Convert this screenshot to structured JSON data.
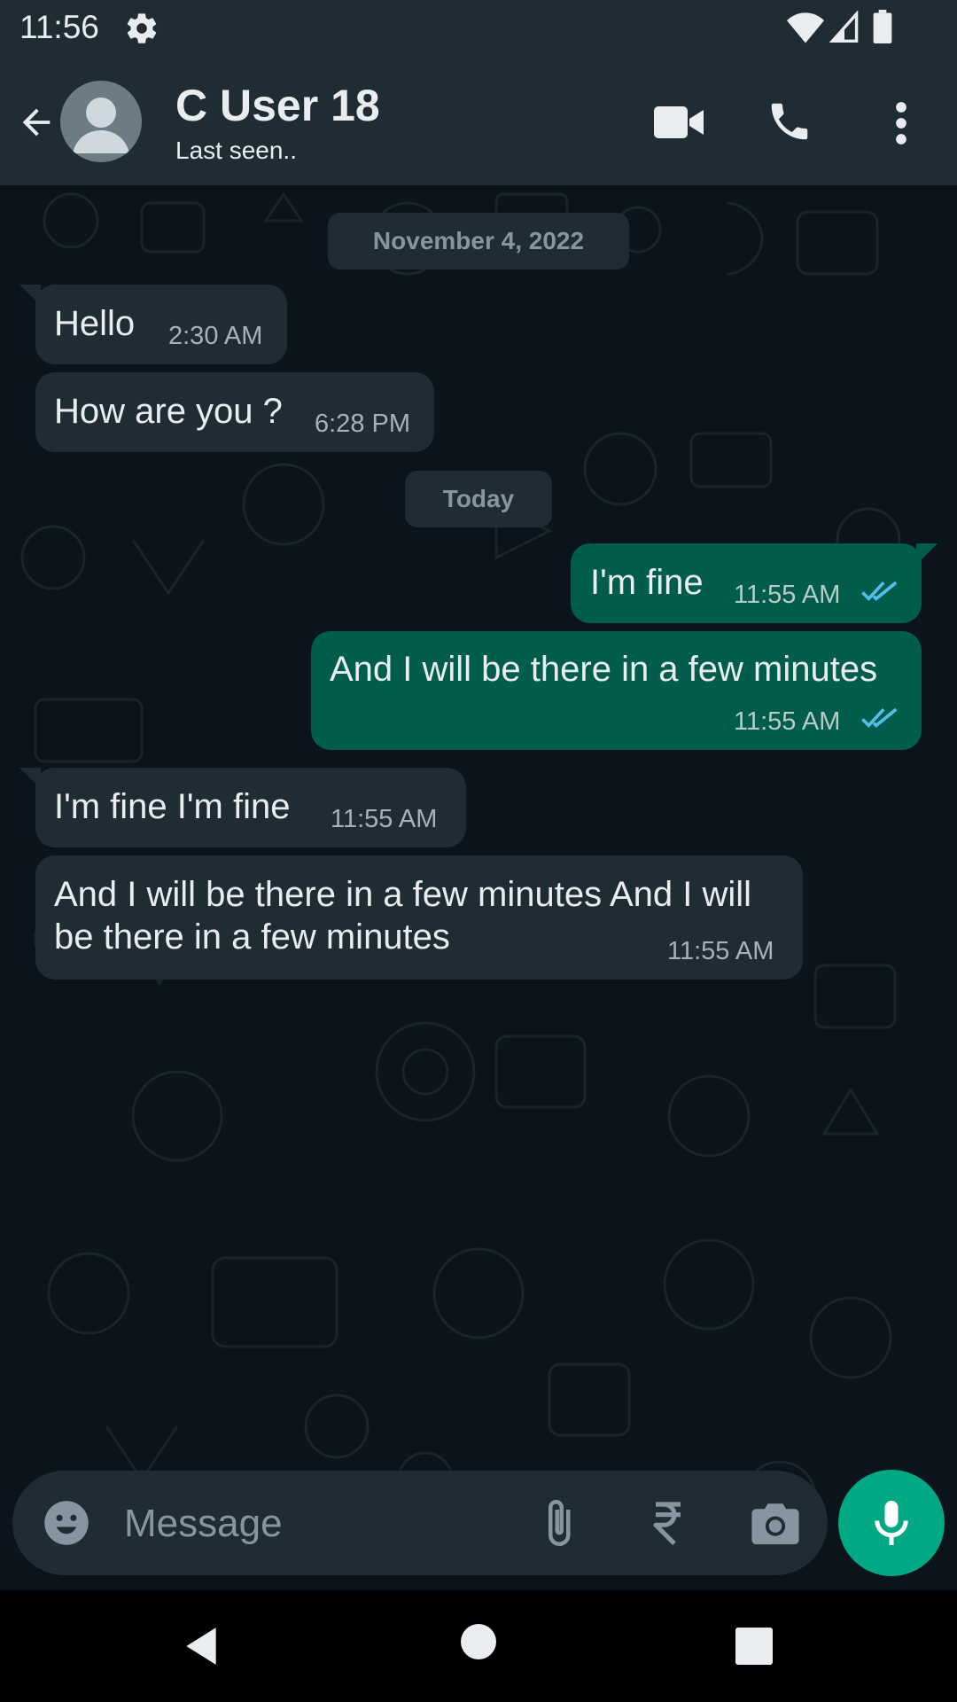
{
  "status_bar": {
    "time": "11:56",
    "icons": [
      "gear-icon",
      "wifi-icon",
      "signal-icon",
      "battery-icon"
    ]
  },
  "header": {
    "contact_name": "C User 18",
    "contact_status": "Last seen..",
    "actions": [
      "video-call-icon",
      "voice-call-icon",
      "more-options-icon"
    ]
  },
  "chat": {
    "date_chips": [
      "November 4, 2022",
      "Today"
    ],
    "messages": [
      {
        "direction": "in",
        "text": "Hello",
        "time": "2:30 AM"
      },
      {
        "direction": "in",
        "text": "How are you ?",
        "time": "6:28 PM"
      },
      {
        "direction": "out",
        "text": "I'm fine",
        "time": "11:55 AM",
        "status": "read"
      },
      {
        "direction": "out",
        "text": "And I will be there in a few minutes",
        "time": "11:55 AM",
        "status": "read"
      },
      {
        "direction": "in",
        "text": "I'm fine I'm fine",
        "time": "11:55 AM"
      },
      {
        "direction": "in",
        "text_line1": "And I will be there in a few minutes And I will",
        "text_line2": "be there in a few minutes",
        "time": "11:55 AM"
      }
    ]
  },
  "composer": {
    "placeholder": "Message",
    "icons": [
      "emoji-icon",
      "attach-icon",
      "rupee-icon",
      "camera-icon",
      "mic-icon"
    ]
  },
  "colors": {
    "background": "#0b141a",
    "bar": "#202c33",
    "incoming_bubble": "#202c33",
    "outgoing_bubble": "#005c4b",
    "accent": "#00a884",
    "read_ticks": "#53bdeb"
  }
}
